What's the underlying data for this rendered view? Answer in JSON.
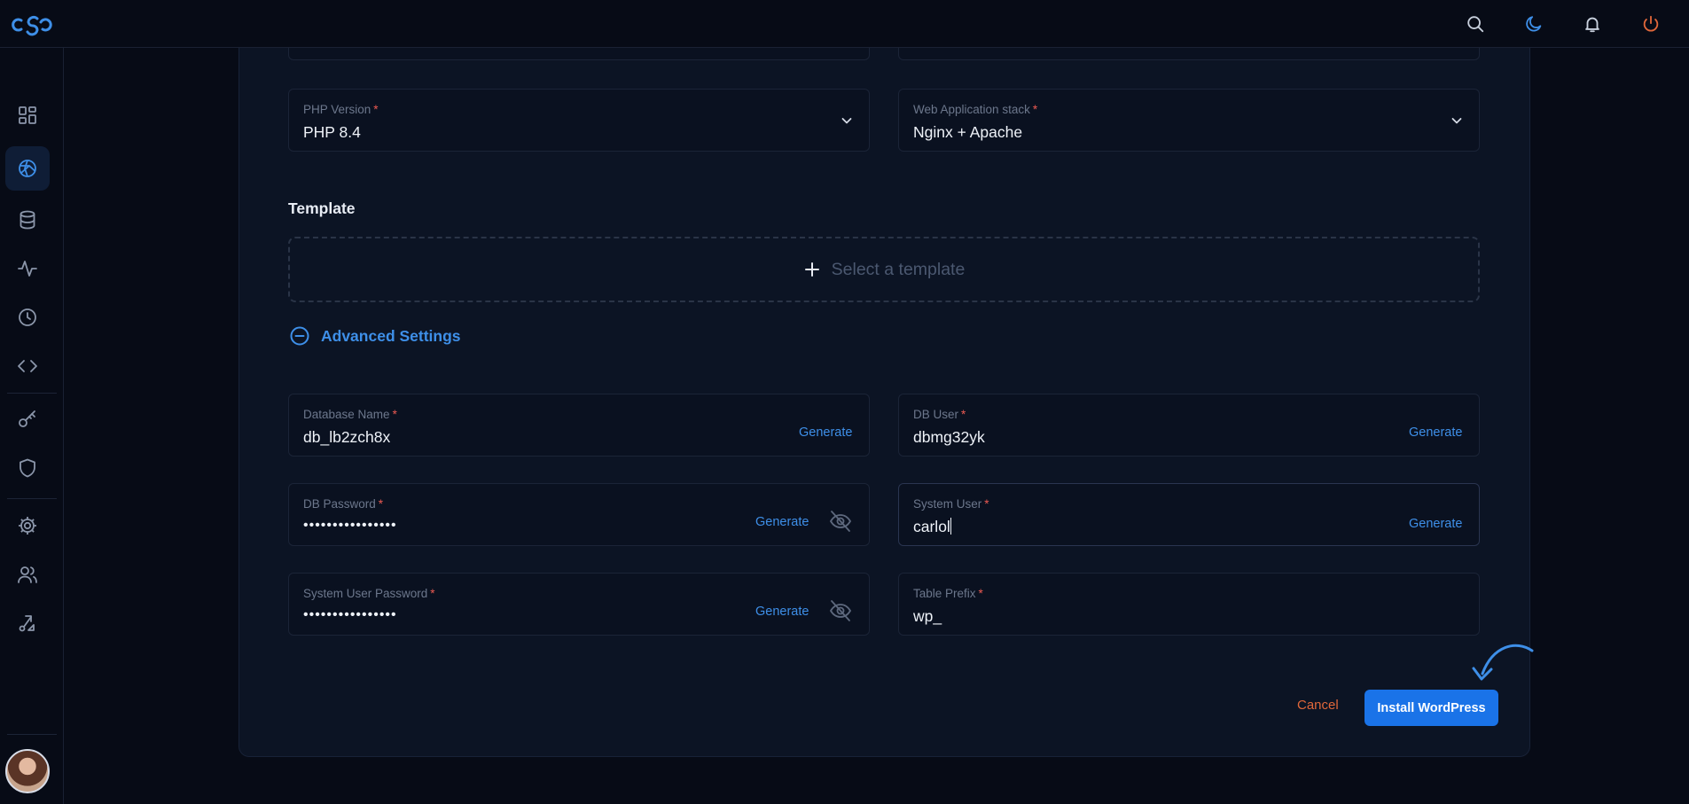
{
  "brand": {
    "logo": "cloudpanel-logo",
    "accent": "#1a73e8"
  },
  "topbar": {
    "icons": [
      "search-icon",
      "moon-icon",
      "bell-icon",
      "power-icon"
    ]
  },
  "sidebar": {
    "items": [
      "dashboard-icon",
      "sites-icon",
      "database-icon",
      "activity-icon",
      "clock-icon",
      "code-icon",
      "key-icon",
      "shield-icon",
      "settings-icon",
      "users-icon",
      "route-icon"
    ],
    "active": "sites-icon"
  },
  "form": {
    "php_version": {
      "label": "PHP Version",
      "value": "PHP 8.4"
    },
    "web_stack": {
      "label": "Web Application stack",
      "value": "Nginx + Apache"
    },
    "template": {
      "title": "Template",
      "placeholder": "Select a template"
    },
    "advanced": {
      "label": "Advanced Settings"
    },
    "db_name": {
      "label": "Database Name",
      "value": "db_lb2zch8x",
      "action": "Generate"
    },
    "db_user": {
      "label": "DB User",
      "value": "dbmg32yk",
      "action": "Generate"
    },
    "db_password": {
      "label": "DB Password",
      "value": "••••••••••••••••",
      "action": "Generate"
    },
    "system_user": {
      "label": "System User",
      "value": "carlol",
      "action": "Generate"
    },
    "system_user_password": {
      "label": "System User Password",
      "value": "••••••••••••••••",
      "action": "Generate"
    },
    "table_prefix": {
      "label": "Table Prefix",
      "value": "wp_"
    },
    "required_mark": "*"
  },
  "actions": {
    "cancel": "Cancel",
    "install": "Install WordPress"
  },
  "colors": {
    "background": "#070b16",
    "card": "#0c1424",
    "link": "#3e8fe8",
    "danger": "#e0673a"
  }
}
